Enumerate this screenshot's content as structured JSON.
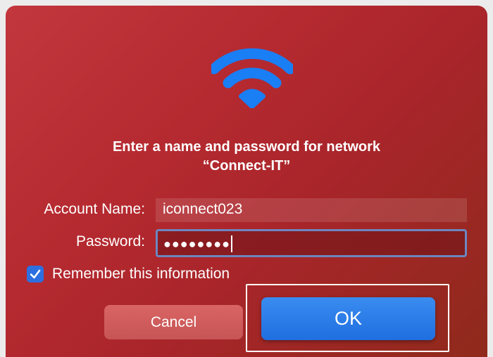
{
  "dialog": {
    "icon": "wifi-icon",
    "title_line1": "Enter a name and password for network",
    "title_line2": "“Connect-IT”"
  },
  "form": {
    "account_label": "Account Name:",
    "account_value": "iconnect023",
    "password_label": "Password:",
    "password_mask": "●●●●●●●●",
    "remember_label": "Remember this information",
    "remember_checked": true
  },
  "buttons": {
    "cancel_label": "Cancel",
    "ok_label": "OK"
  },
  "colors": {
    "dialog_background": "#b52a30",
    "accent": "#1f6fe0",
    "wifi_icon": "#1a7ef5"
  }
}
